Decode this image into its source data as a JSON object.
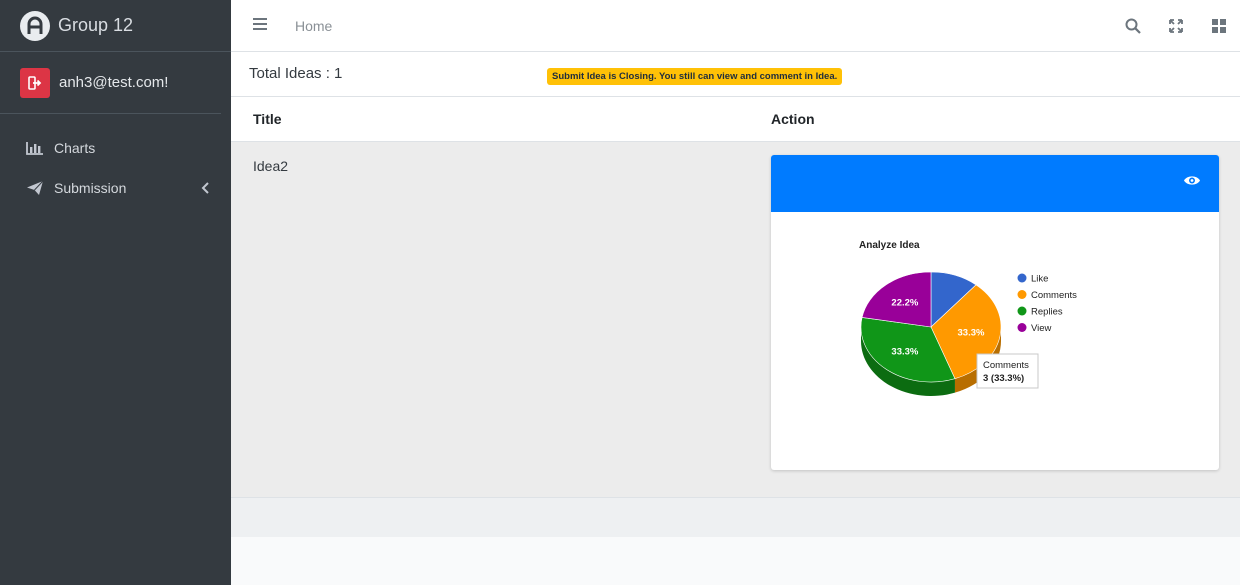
{
  "brand": {
    "title": "Group 12",
    "logo_letter": "A"
  },
  "user": {
    "email": "anh3@test.com!"
  },
  "sidebar": {
    "items": [
      {
        "label": "Charts",
        "icon": "bar-chart-icon"
      },
      {
        "label": "Submission",
        "icon": "paper-plane-icon",
        "chevron": "chevron-left-icon"
      }
    ]
  },
  "topbar": {
    "home_label": "Home",
    "icons": [
      "search-icon",
      "expand-icon",
      "grid-icon"
    ]
  },
  "summary": {
    "total_ideas": "Total Ideas : 1",
    "warning": "Submit Idea is Closing. You still can view and comment in Idea."
  },
  "table": {
    "headers": {
      "title": "Title",
      "action": "Action"
    },
    "rows": [
      {
        "title": "Idea2"
      }
    ]
  },
  "colors": {
    "sidebar_bg": "#343a40",
    "primary": "#007bff",
    "warning": "#ffc107",
    "danger": "#dc3545"
  },
  "chart_data": {
    "type": "pie",
    "title": "Analyze Idea",
    "is3d": true,
    "categories": [
      "Like",
      "Comments",
      "Replies",
      "View"
    ],
    "values": [
      1,
      3,
      3,
      2
    ],
    "percent_labels": [
      "",
      "33.3%",
      "33.3%",
      "22.2%"
    ],
    "colors": [
      "#3366cc",
      "#ff9900",
      "#109618",
      "#990099"
    ],
    "legend": "right",
    "tooltip": {
      "label": "Comments",
      "value": "3 (33.3%)"
    }
  }
}
